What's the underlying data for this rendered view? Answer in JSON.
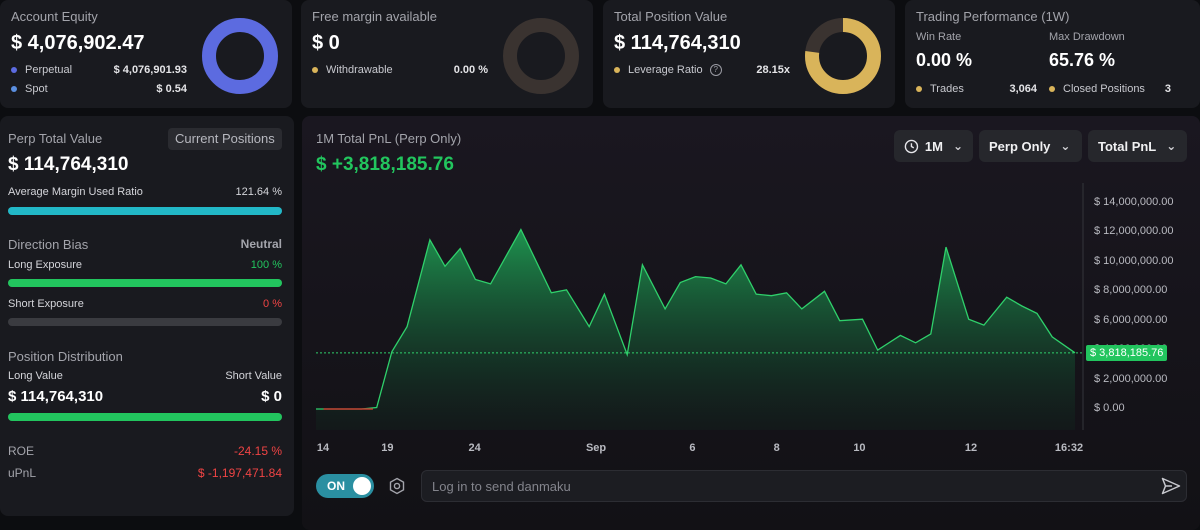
{
  "equity": {
    "title": "Account Equity",
    "value": "$ 4,076,902.47",
    "perpetual_label": "Perpetual",
    "perpetual_value": "$ 4,076,901.93",
    "spot_label": "Spot",
    "spot_value": "$ 0.54",
    "donut_color": "#5c6be0",
    "dot_perp_color": "#5c6be0",
    "dot_spot_color": "#5b8fe0"
  },
  "margin": {
    "title": "Free margin available",
    "value": "$ 0",
    "withdrawable_label": "Withdrawable",
    "withdrawable_value": "0.00 %"
  },
  "position": {
    "title": "Total Position Value",
    "value": "$ 114,764,310",
    "leverage_label": "Leverage Ratio",
    "leverage_value": "28.15x",
    "donut_color": "#d9b45a"
  },
  "performance": {
    "title": "Trading Performance (1W)",
    "win_rate_label": "Win Rate",
    "win_rate_value": "0.00 %",
    "drawdown_label": "Max Drawdown",
    "drawdown_value": "65.76 %",
    "trades_label": "Trades",
    "trades_value": "3,064",
    "closed_label": "Closed Positions",
    "closed_value": "3"
  },
  "perp": {
    "title": "Perp Total Value",
    "tab_label": "Current Positions",
    "value": "$ 114,764,310",
    "margin_ratio_label": "Average Margin Used Ratio",
    "margin_ratio_value": "121.64 %",
    "margin_ratio_fill": 1.0,
    "direction_title": "Direction Bias",
    "direction_value": "Neutral",
    "long_exposure_label": "Long Exposure",
    "long_exposure_value": "100 %",
    "long_exposure_fill": 1.0,
    "short_exposure_label": "Short Exposure",
    "short_exposure_value": "0 %",
    "short_exposure_fill": 0.0,
    "distribution_title": "Position Distribution",
    "long_value_label": "Long Value",
    "short_value_label": "Short Value",
    "long_value": "$ 114,764,310",
    "short_value": "$ 0",
    "distribution_fill": 1.0,
    "roe_label": "ROE",
    "roe_value": "-24.15 %",
    "upnl_label": "uPnL",
    "upnl_value": "$ -1,197,471.84"
  },
  "pnl": {
    "title": "1M Total PnL (Perp Only)",
    "value": "$ +3,818,185.76",
    "range_label": "1M",
    "filter_label": "Perp Only",
    "metric_label": "Total PnL",
    "current_badge": "$ 3,818,185.76"
  },
  "danmaku": {
    "toggle_label": "ON",
    "placeholder": "Log in to send danmaku"
  },
  "colors": {
    "green": "#22c55e",
    "red": "#ef4444",
    "teal": "#22b8c7",
    "gold": "#d9b45a"
  },
  "chart_data": {
    "type": "area",
    "y_tick_labels": [
      "$ 14,000,000.00",
      "$ 12,000,000.00",
      "$ 10,000,000.00",
      "$ 8,000,000.00",
      "$ 6,000,000.00",
      "$ 4,000,000.00",
      "$ 2,000,000.00",
      "$ 0.00"
    ],
    "y_ticks": [
      14000000,
      12000000,
      10000000,
      8000000,
      6000000,
      4000000,
      2000000,
      0
    ],
    "x_tick_labels": [
      "14",
      "19",
      "24",
      "Sep",
      "6",
      "8",
      "10",
      "12",
      "16:32"
    ],
    "x_tick_pos": [
      0,
      0.094,
      0.209,
      0.369,
      0.496,
      0.607,
      0.716,
      0.863,
      1.0
    ],
    "ylim": [
      0,
      15000000
    ],
    "current_value": 3818185.76,
    "series": [
      {
        "x": [
          0,
          0.03,
          0.06,
          0.08,
          0.1,
          0.12,
          0.15,
          0.17,
          0.19,
          0.21,
          0.23,
          0.27,
          0.31,
          0.33,
          0.36,
          0.38,
          0.41,
          0.43,
          0.46,
          0.48,
          0.5,
          0.52,
          0.54,
          0.56,
          0.58,
          0.6,
          0.62,
          0.64,
          0.67,
          0.69,
          0.72,
          0.74,
          0.77,
          0.79,
          0.81,
          0.83,
          0.86,
          0.88,
          0.91,
          0.93,
          0.95,
          0.97,
          1.0
        ],
        "y": [
          0,
          0,
          0,
          100000,
          3900000,
          5600000,
          11500000,
          9700000,
          10900000,
          8800000,
          8500000,
          12200000,
          7900000,
          8100000,
          5600000,
          7800000,
          3700000,
          9800000,
          6800000,
          8600000,
          9000000,
          8900000,
          8500000,
          9800000,
          7800000,
          7700000,
          7900000,
          6800000,
          8000000,
          6000000,
          6100000,
          4000000,
          5000000,
          4500000,
          5100000,
          11000000,
          6100000,
          5700000,
          7600000,
          7000000,
          6500000,
          4900000,
          3818185.76
        ]
      }
    ]
  }
}
